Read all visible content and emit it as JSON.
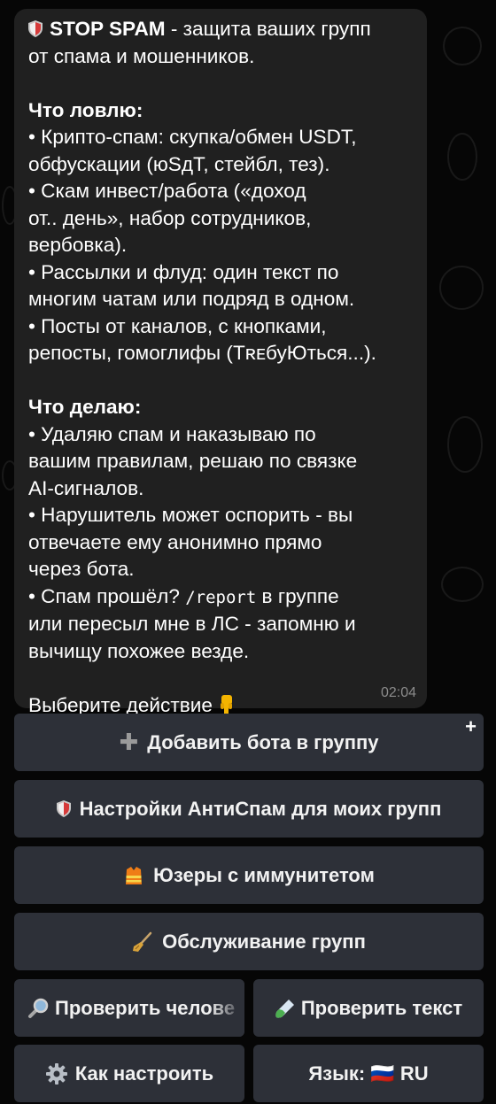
{
  "message": {
    "header_title": "STOP SPAM",
    "header_rest": " - защита ваших групп",
    "header_line2": "от спама и мошенников.",
    "section1_title": "Что ловлю:",
    "s1_lines": [
      "• Крипто-спам: скупка/обмен USDT,",
      "обфускации (юSдT, стейбл, тез).",
      "• Скам инвест/работа («доход",
      "от.. день», набор сотрудников,",
      "вербовка).",
      "• Рассылки и флуд: один текст по",
      "многим чатам или подряд в одном.",
      "• Посты от каналов, с кнопками,",
      "репосты, гомоглифы (TʀᴇбуЮться...)."
    ],
    "section2_title": "Что делаю:",
    "s2_lines": [
      "• Удаляю спам и наказываю по",
      "вашим правилам, решаю по связке",
      "AI-сигналов.",
      "• Нарушитель может оспорить - вы",
      "отвечаете ему анонимно прямо",
      "через бота."
    ],
    "s2_spam_before": "• Спам прошёл? ",
    "s2_command": "/report",
    "s2_spam_after": " в группе",
    "s2_tail_lines": [
      "или пересыл мне в ЛС - запомню и",
      "вычищу похожее везде."
    ],
    "choose_action": "Выберите действие",
    "time": "02:04"
  },
  "keyboard": {
    "add_bot": "Добавить бота в группу",
    "add_corner": "+",
    "settings": "Настройки АнтиСпам для моих групп",
    "immunity": "Юзеры с иммунитетом",
    "maintenance": "Обслуживание групп",
    "check_user": "Проверить челове",
    "check_text": "Проверить текст",
    "how_to": "Как настроить",
    "language": "Язык: 🇷🇺 RU"
  },
  "icons": {
    "shield": "shield-icon",
    "hand": "pointing-down-icon",
    "plus": "plus-icon",
    "vest": "safety-vest-icon",
    "broom": "broom-icon",
    "magnifier": "magnifier-icon",
    "test_tube": "test-tube-icon",
    "gear": "gear-icon",
    "flag": "russia-flag-icon"
  },
  "colors": {
    "bubble": "#202020",
    "button": "#2d3038",
    "background": "#060606",
    "time": "#8b8b8b"
  }
}
